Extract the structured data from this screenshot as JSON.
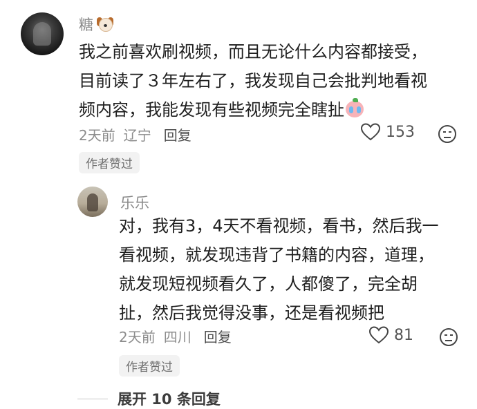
{
  "comment": {
    "author": "糖",
    "text_lines": [
      "我之前喜欢刷视频，而且无论什么内容都接受，",
      "目前读了３年左右了，我发现自己会批判地看视",
      "频内容，我能发现有些视频完全瞎扯"
    ],
    "time": "2天前",
    "location": "辽宁",
    "reply_label": "回复",
    "likes": "153",
    "tag": "作者赞过"
  },
  "reply": {
    "author": "乐乐",
    "text_lines": [
      "对，我有3，4天不看视频，看书，然后我一",
      "看视频，就发现违背了书籍的内容，道理，",
      "就发现短视频看久了，人都傻了，完全胡",
      "扯，然后我觉得没事，还是看视频把"
    ],
    "time": "2天前",
    "location": "四川",
    "reply_label": "回复",
    "likes": "81",
    "tag": "作者赞过"
  },
  "expand_label": "展开 10 条回复",
  "icons": [
    "dog-emoji-icon",
    "crying-emoji-icon",
    "heart-icon",
    "dislike-face-icon"
  ]
}
